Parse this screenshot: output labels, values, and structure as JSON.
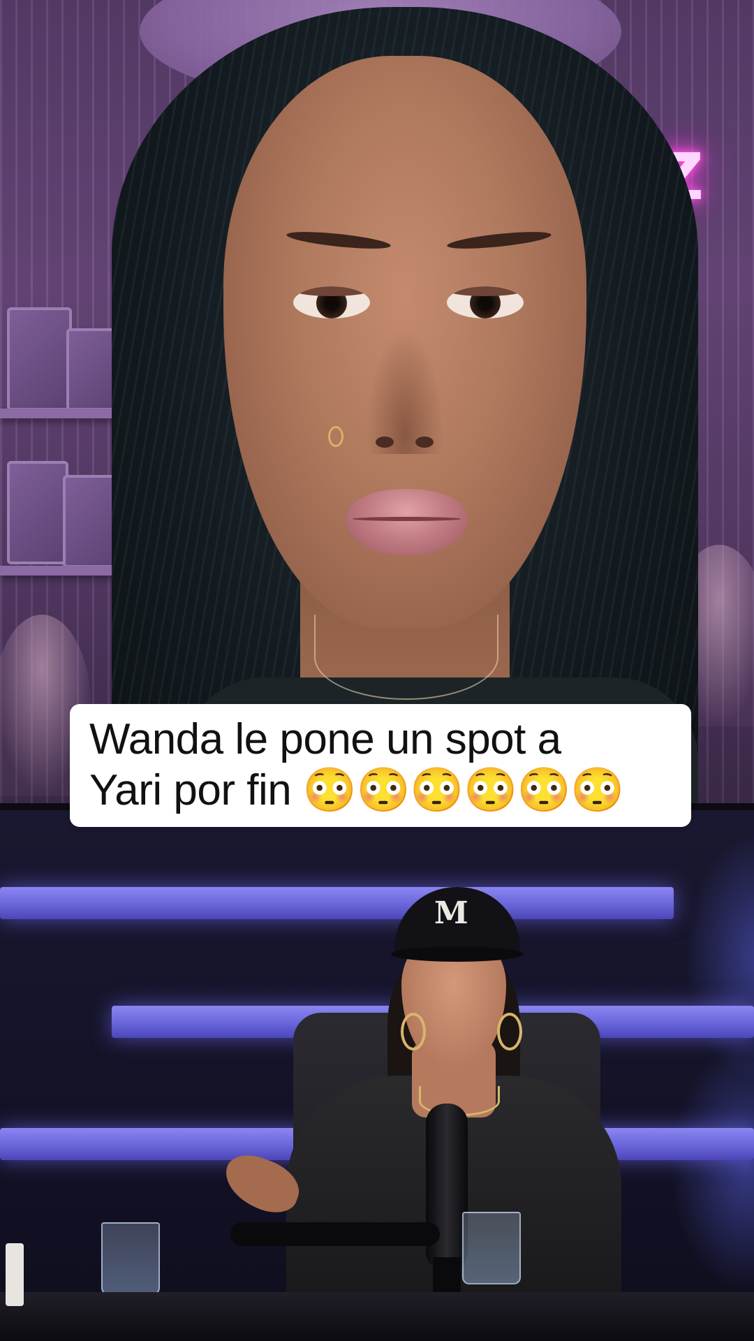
{
  "caption": {
    "line1": "Wanda le pone un spot a",
    "line2": "Yari por fin 😳😳😳😳😳😳"
  },
  "top_video": {
    "neon_sign_text": "IZ"
  },
  "bottom_video": {
    "cap_logo_text": "M"
  },
  "colors": {
    "caption_background": "#ffffff",
    "caption_text": "#111111",
    "top_background": "#6d4a80",
    "neon": "#ff4fe0",
    "studio_led": "#6d68dd"
  }
}
